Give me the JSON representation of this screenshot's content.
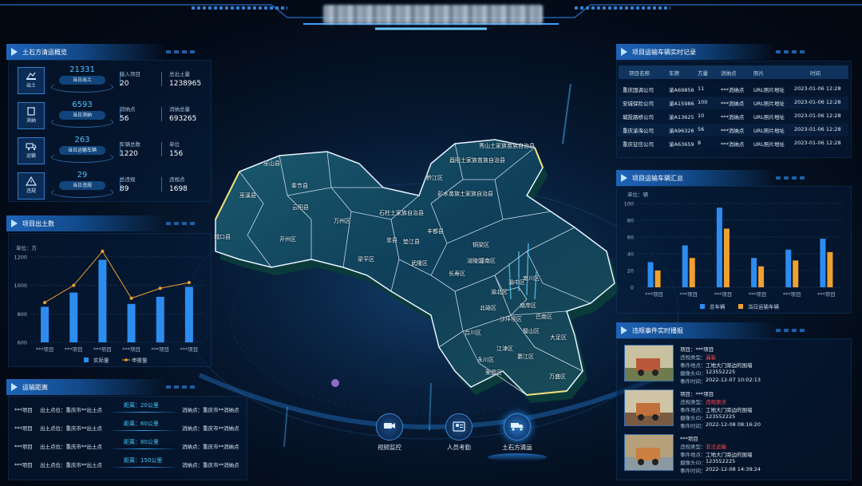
{
  "header": {
    "title": ""
  },
  "panels": {
    "overview": {
      "title": "土石方清运概览",
      "rows": [
        {
          "icon_name": "excavate-icon",
          "icon_label": "出土",
          "big": "21331",
          "sub": "当日出土",
          "k1": "接入项目",
          "v1": "20",
          "k2": "总出土量",
          "v2": "1238965"
        },
        {
          "icon_name": "disposal-icon",
          "icon_label": "消纳",
          "big": "6593",
          "sub": "当日消纳",
          "k1": "消纳点",
          "v1": "56",
          "k2": "消纳总量",
          "v2": "693265"
        },
        {
          "icon_name": "truck-icon",
          "icon_label": "运输",
          "big": "263",
          "sub": "当日运输车辆",
          "k1": "车辆总数",
          "v1": "1220",
          "k2": "单位",
          "v2": "156"
        },
        {
          "icon_name": "warning-icon",
          "icon_label": "违规",
          "big": "29",
          "sub": "当日违规",
          "k1": "总违规",
          "v1": "89",
          "k2": "违规点",
          "v2": "1698"
        }
      ]
    },
    "output": {
      "title": "项目出土数",
      "unit": "单位：方",
      "legend_actual": "实际量",
      "legend_declared": "申报量"
    },
    "distance": {
      "title": "运输距离",
      "rows": [
        {
          "project": "***项目",
          "origin": "出土点位：重庆市**出土点",
          "distance": "距离：20公里",
          "dest": "消纳点：重庆市**消纳点"
        },
        {
          "project": "***项目",
          "origin": "出土点位：重庆市**出土点",
          "distance": "距离：60公里",
          "dest": "消纳点：重庆市**消纳点"
        },
        {
          "project": "***项目",
          "origin": "出土点位：重庆市**出土点",
          "distance": "距离：80公里",
          "dest": "消纳点：重庆市**消纳点"
        },
        {
          "project": "***项目",
          "origin": "出土点位：重庆市**出土点",
          "distance": "距离：150公里",
          "dest": "消纳点：重庆市**消纳点"
        }
      ]
    },
    "realtime": {
      "title": "项目运输车辆实时记录",
      "columns": [
        "项目名称",
        "车牌",
        "方量",
        "消纳点",
        "照片",
        "时间"
      ],
      "rows": [
        [
          "重庆国调公司",
          "渝A69856",
          "11",
          "***消纳点",
          "URL照片地址",
          "2023-01-06  12:28"
        ],
        [
          "安城保险公司",
          "渝A15986",
          "100",
          "***消纳点",
          "URL照片地址",
          "2023-01-06  12:28"
        ],
        [
          "城投路桥公司",
          "渝A13625",
          "10",
          "***消纳点",
          "URL照片地址",
          "2023-01-06  12:28"
        ],
        [
          "重庆渝海公司",
          "渝A96326",
          "56",
          "***消纳点",
          "URL照片地址",
          "2023-01-06  12:28"
        ],
        [
          "重庆征信公司",
          "渝A63659",
          "8",
          "***消纳点",
          "URL照片地址",
          "2023-01-06  12:28"
        ]
      ]
    },
    "summary": {
      "title": "项目运输车辆汇总",
      "unit": "单位：辆",
      "legend_total": "总车辆",
      "legend_today": "当日运输车辆"
    },
    "events": {
      "title": "违规事件实时播报",
      "items": [
        {
          "project": "项目：***项目",
          "type_k": "违规类型：",
          "type_v": "漏装",
          "addr_k": "事件地点：",
          "addr_v": "工地大门旁边的围墙",
          "cam_k": "摄像头ID：",
          "cam_v": "123552225",
          "time_k": "事件时间：",
          "time_v": "2022-12-07    10:02:13"
        },
        {
          "project": "项目：***项目",
          "type_k": "违规类型：",
          "type_v": "违规原点",
          "addr_k": "事件地点：",
          "addr_v": "工地大门旁边的围墙",
          "cam_k": "摄像头ID：",
          "cam_v": "123552225",
          "time_k": "事件时间：",
          "time_v": "2022-12-08    08:16:20"
        },
        {
          "project": "***项目",
          "type_k": "违规类型：",
          "type_v": "非法运输",
          "addr_k": "事件地点：",
          "addr_v": "工地大门旁边的围墙",
          "cam_k": "摄像头ID：",
          "cam_v": "123552225",
          "time_k": "事件时间：",
          "time_v": "2022-12-08    14:39:24"
        }
      ]
    }
  },
  "map": {
    "labels": [
      "巫山县",
      "奉节县",
      "巫溪县",
      "云阳县",
      "开州区",
      "万州区",
      "城口县",
      "秀山土家族苗族自治县",
      "酉阳土家族苗族自治县",
      "黔江区",
      "彭水苗族土家族自治县",
      "石柱土家族自治县",
      "忠县",
      "丰都县",
      "武隆区",
      "梁平区",
      "垫江县",
      "长寿区",
      "涪陵区",
      "南川区",
      "綦江区",
      "渝北区",
      "北碚区",
      "合川区",
      "江津区",
      "永川区",
      "大足区",
      "荣昌区",
      "潼南区",
      "万盛区",
      "南岸区",
      "巴南区",
      "渝中区",
      "沙坪坝区",
      "璧山区",
      "铜梁区"
    ]
  },
  "nav": [
    {
      "label": "视频监控",
      "icon_name": "camera-icon"
    },
    {
      "label": "人员考勤",
      "icon_name": "person-badge-icon"
    },
    {
      "label": "土石方清运",
      "icon_name": "dump-truck-icon"
    }
  ],
  "chart_data": [
    {
      "type": "bar",
      "title": "项目出土数",
      "ylabel": "单位：方",
      "categories": [
        "***项目",
        "***项目",
        "***项目",
        "***项目",
        "***项目",
        "***项目"
      ],
      "ylim": [
        600,
        1200
      ],
      "yticks": [
        600,
        800,
        1000,
        1200
      ],
      "series": [
        {
          "name": "实际量",
          "kind": "bar",
          "values": [
            850,
            950,
            1180,
            870,
            920,
            990
          ]
        },
        {
          "name": "申报量",
          "kind": "line",
          "values": [
            880,
            1000,
            1240,
            910,
            980,
            1020
          ]
        }
      ]
    },
    {
      "type": "bar",
      "title": "项目运输车辆汇总",
      "ylabel": "单位：辆",
      "categories": [
        "***项目",
        "***项目",
        "***项目",
        "***项目",
        "***项目",
        "***项目"
      ],
      "ylim": [
        0,
        100
      ],
      "yticks": [
        0,
        20,
        40,
        60,
        80,
        100
      ],
      "series": [
        {
          "name": "总车辆",
          "values": [
            30,
            50,
            95,
            35,
            45,
            58
          ]
        },
        {
          "name": "当日运输车辆",
          "values": [
            20,
            35,
            70,
            25,
            32,
            42
          ]
        }
      ]
    }
  ],
  "colors": {
    "accent": "#2a8cf0",
    "bar_blue": "#2d8cf0",
    "bar_orange": "#f0a030",
    "line_orange": "#f0a030",
    "danger": "#ff4a4a"
  }
}
